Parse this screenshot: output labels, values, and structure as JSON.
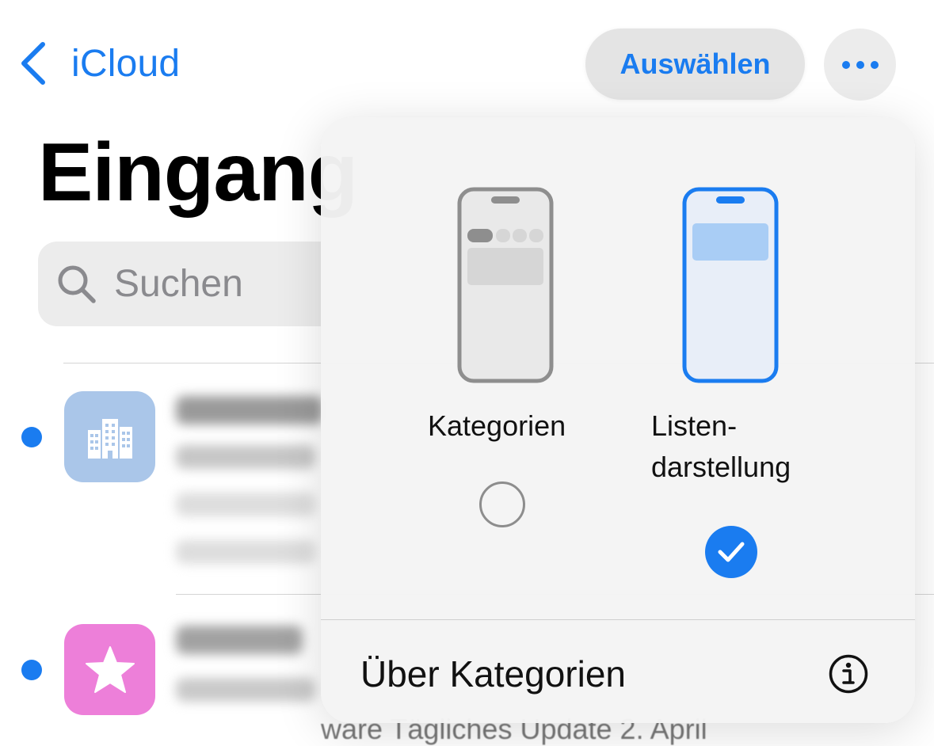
{
  "nav": {
    "back_label": "iCloud",
    "select_label": "Auswählen"
  },
  "page": {
    "title": "Eingang"
  },
  "search": {
    "placeholder": "Suchen"
  },
  "popover": {
    "options": [
      {
        "label": "Kategorien",
        "selected": false
      },
      {
        "label_line1": "Listen-",
        "label_line2": "darstellung",
        "selected": true
      }
    ],
    "about_label": "Über Kategorien"
  },
  "background_row_text": "ware Tägliches Update   2. April",
  "colors": {
    "accent": "#1a7cf0",
    "tile_building": "#aac6e9",
    "tile_star": "#ed7fd9"
  },
  "icons": {
    "back": "chevron-left-icon",
    "more": "ellipsis-icon",
    "search": "search-icon",
    "tile1": "buildings-icon",
    "tile2": "star-icon",
    "info": "info-circle-icon",
    "check": "checkmark-icon"
  }
}
